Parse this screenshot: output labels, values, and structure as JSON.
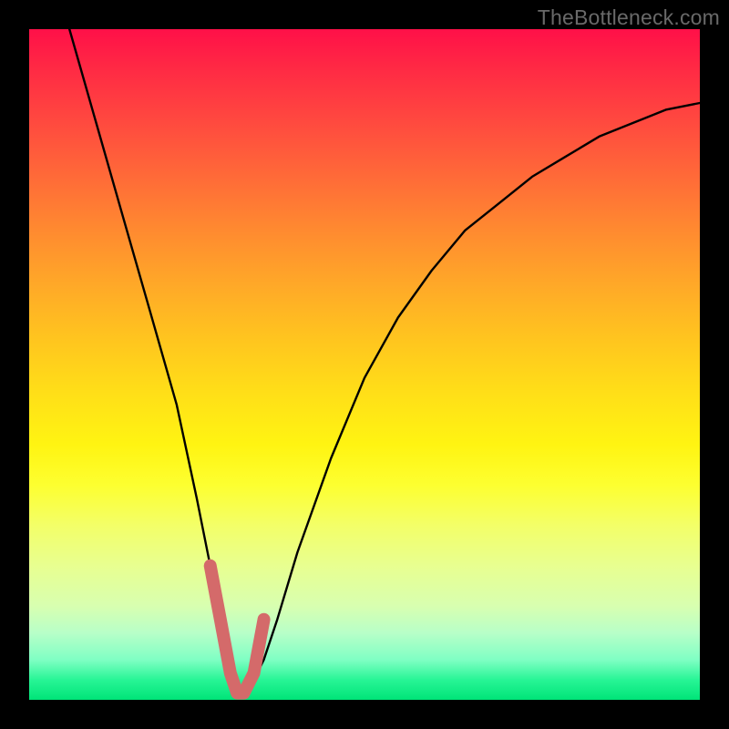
{
  "watermark": {
    "text": "TheBottleneck.com"
  },
  "chart_data": {
    "type": "line",
    "title": "",
    "xlabel": "",
    "ylabel": "",
    "xlim": [
      0,
      100
    ],
    "ylim": [
      0,
      100
    ],
    "grid": false,
    "legend": false,
    "series": [
      {
        "name": "bottleneck-curve",
        "x": [
          6,
          10,
          14,
          18,
          22,
          25,
          27,
          29,
          30,
          31,
          32,
          33,
          35,
          37,
          40,
          45,
          50,
          55,
          60,
          65,
          70,
          75,
          80,
          85,
          90,
          95,
          100
        ],
        "values": [
          100,
          86,
          72,
          58,
          44,
          30,
          20,
          10,
          4,
          1,
          1,
          2,
          6,
          12,
          22,
          36,
          48,
          57,
          64,
          70,
          74,
          78,
          81,
          84,
          86,
          88,
          89
        ]
      }
    ],
    "highlight_segment": {
      "name": "optimal-range-marker",
      "color": "#d46a6a",
      "x": [
        27,
        28.5,
        30,
        31,
        32,
        33.5,
        35
      ],
      "values": [
        20,
        12,
        4,
        1,
        1,
        4,
        12
      ]
    },
    "gradient_stops": [
      {
        "pos": 0.0,
        "color": "#ff1048"
      },
      {
        "pos": 0.25,
        "color": "#ff7a34"
      },
      {
        "pos": 0.5,
        "color": "#ffd21c"
      },
      {
        "pos": 0.7,
        "color": "#f8ff58"
      },
      {
        "pos": 0.9,
        "color": "#b8ffc8"
      },
      {
        "pos": 1.0,
        "color": "#00e478"
      }
    ]
  }
}
